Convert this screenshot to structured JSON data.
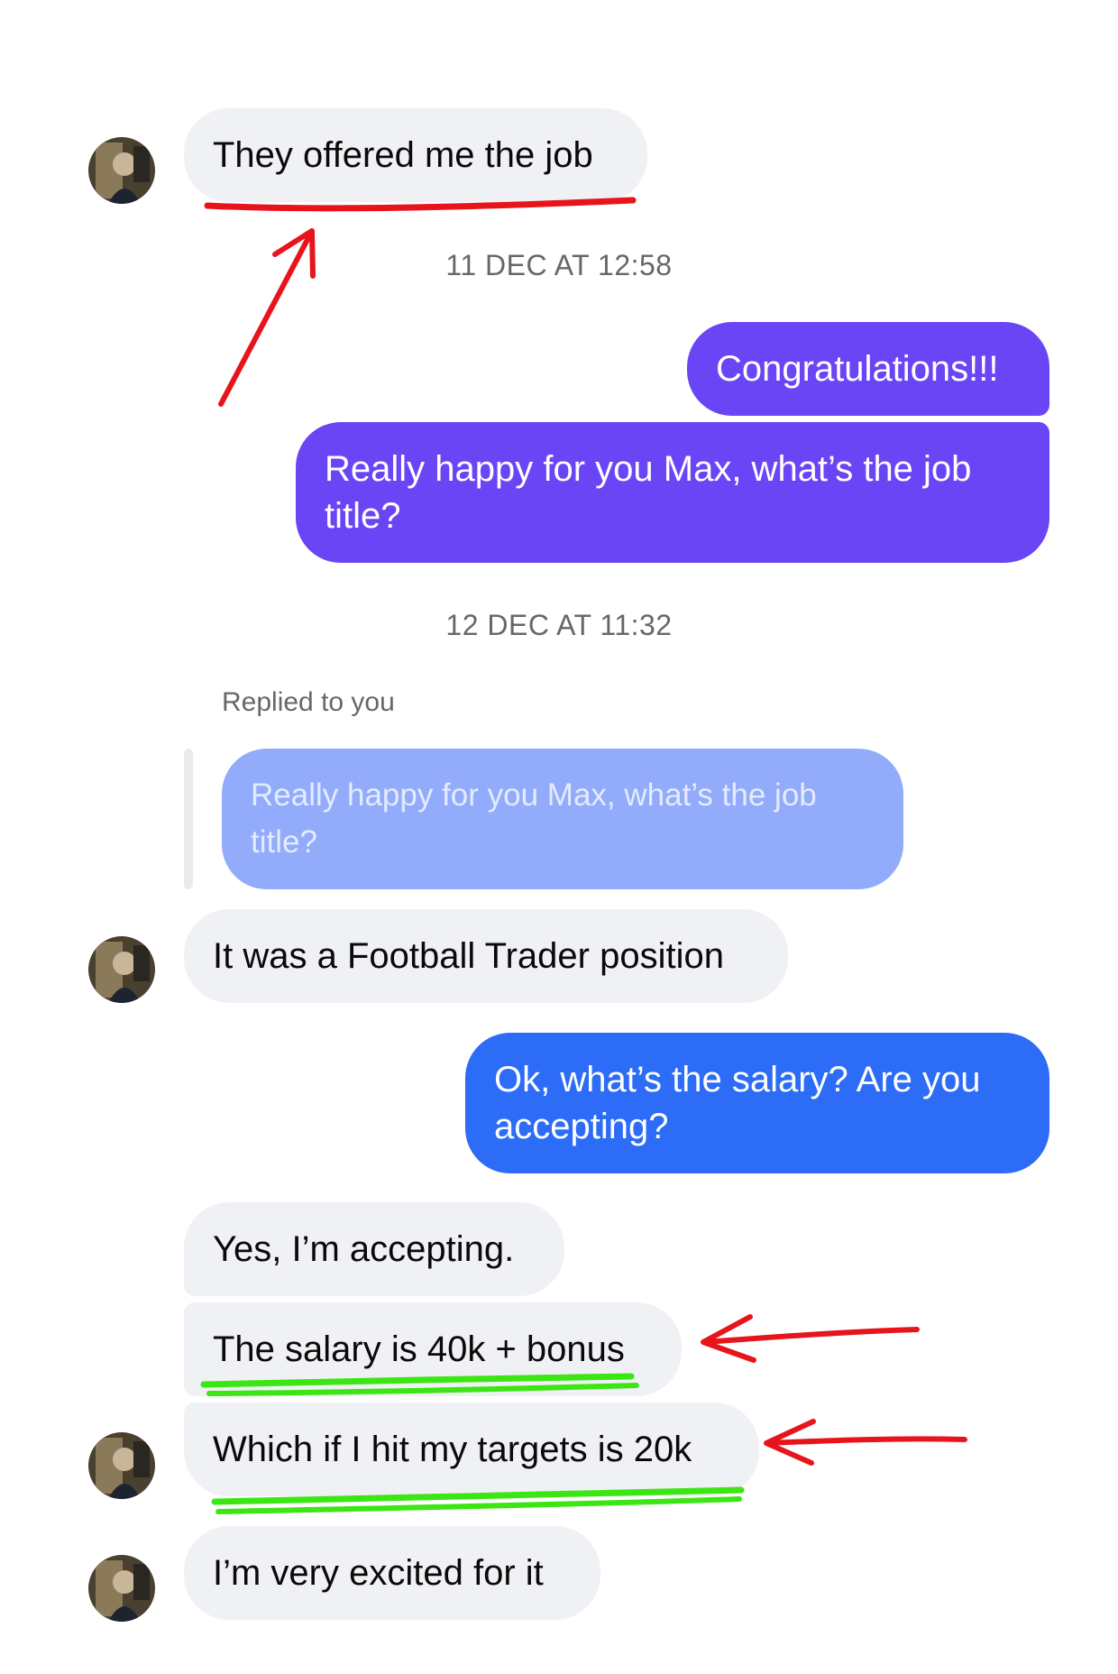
{
  "conversation": {
    "messages": [
      {
        "text": "They offered me the job"
      },
      {
        "timestamp": "11 DEC AT 12:58"
      },
      {
        "text": "Congratulations!!!"
      },
      {
        "text": "Really happy for you Max, what’s the job\ntitle?"
      },
      {
        "timestamp": "12 DEC AT 11:32"
      },
      {
        "label": "Replied to you",
        "quoted": "Really happy for you Max, what’s the job\ntitle?"
      },
      {
        "text": "It was a Football Trader position"
      },
      {
        "text": "Ok, what’s the salary? Are you\naccepting?"
      },
      {
        "text": "Yes, I’m accepting."
      },
      {
        "text": "The salary is 40k + bonus"
      },
      {
        "text": "Which if I hit my targets is 20k"
      },
      {
        "text": "I’m very excited for it"
      }
    ]
  },
  "colors": {
    "incoming_bubble": "#f0f1f4",
    "outgoing_purple": "#6a45f5",
    "outgoing_blue": "#2c6cf6",
    "quoted_bubble": "#92acfb",
    "red_annotation": "#e8141c",
    "green_annotation": "#3ce614"
  },
  "icons": [
    "avatar-icon"
  ]
}
